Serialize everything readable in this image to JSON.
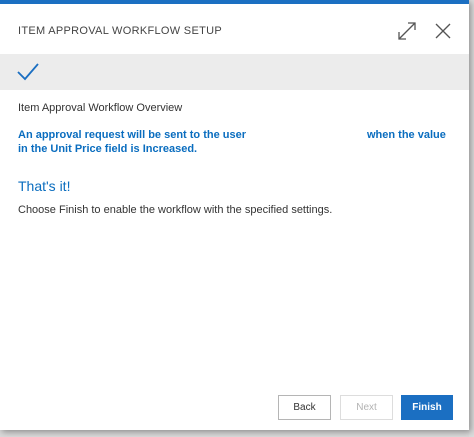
{
  "dialog": {
    "title": "ITEM APPROVAL WORKFLOW SETUP"
  },
  "icons": {
    "expand": "expand-icon",
    "close": "close-icon",
    "check": "checkmark-icon"
  },
  "content": {
    "overview_title": "Item Approval Workflow Overview",
    "request_part1": "An approval request will be sent to the user",
    "request_part2": "when the value",
    "request_line2": "in the Unit Price field is Increased.",
    "thats_it": "That's it!",
    "finish_hint": "Choose Finish to enable the workflow with the specified settings."
  },
  "buttons": {
    "back": "Back",
    "next": "Next",
    "finish": "Finish"
  },
  "colors": {
    "accent": "#1b6fc2",
    "emphasis_text": "#0a6dbf"
  }
}
